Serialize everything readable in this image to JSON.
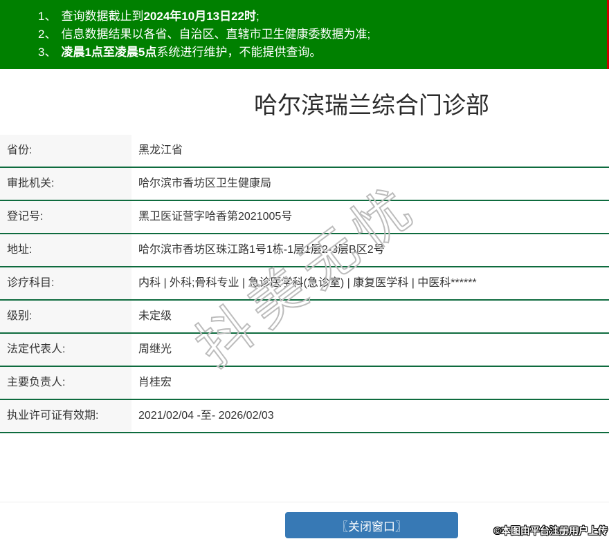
{
  "notice": {
    "lines": [
      {
        "num": "1、",
        "pre": "查询数据截止到",
        "bold": "2024年10月13日22时",
        "post": ";"
      },
      {
        "num": "2、",
        "pre": "信息数据结果以各省、自治区、直辖市卫生健康委数据为准;",
        "bold": "",
        "post": ""
      },
      {
        "num": "3、",
        "pre": "",
        "bold": "凌晨1点至凌晨5点",
        "post": "系统进行维护，不能提供查询。"
      }
    ]
  },
  "page": {
    "title": "哈尔滨瑞兰综合门诊部"
  },
  "table": {
    "rows": [
      {
        "label": "省份:",
        "value": "黑龙江省"
      },
      {
        "label": "审批机关:",
        "value": "哈尔滨市香坊区卫生健康局"
      },
      {
        "label": "登记号:",
        "value": "黑卫医证营字哈香第2021005号"
      },
      {
        "label": "地址:",
        "value": "哈尔滨市香坊区珠江路1号1栋-1层1层2-3层B区2号"
      },
      {
        "label": "诊疗科目:",
        "value": "内科 | 外科;骨科专业 | 急诊医学科(急诊室) | 康复医学科 | 中医科******"
      },
      {
        "label": "级别:",
        "value": "未定级"
      },
      {
        "label": "法定代表人:",
        "value": "周继光"
      },
      {
        "label": "主要负责人:",
        "value": "肖桂宏"
      },
      {
        "label": "执业许可证有效期:",
        "value": "2021/02/04 -至- 2026/02/03"
      }
    ]
  },
  "footer": {
    "close_button_label": "〖关闭窗口〗"
  },
  "watermark": {
    "diagonal_text": "抖美无忧",
    "photo_credit": "©本图由平台注册用户上传"
  },
  "colors": {
    "banner_green": "#008000",
    "row_border_green": "#0e6b3e",
    "button_blue": "#3779b5",
    "red_stripe": "#cc0000",
    "label_cell_bg": "#f7f7f7"
  }
}
